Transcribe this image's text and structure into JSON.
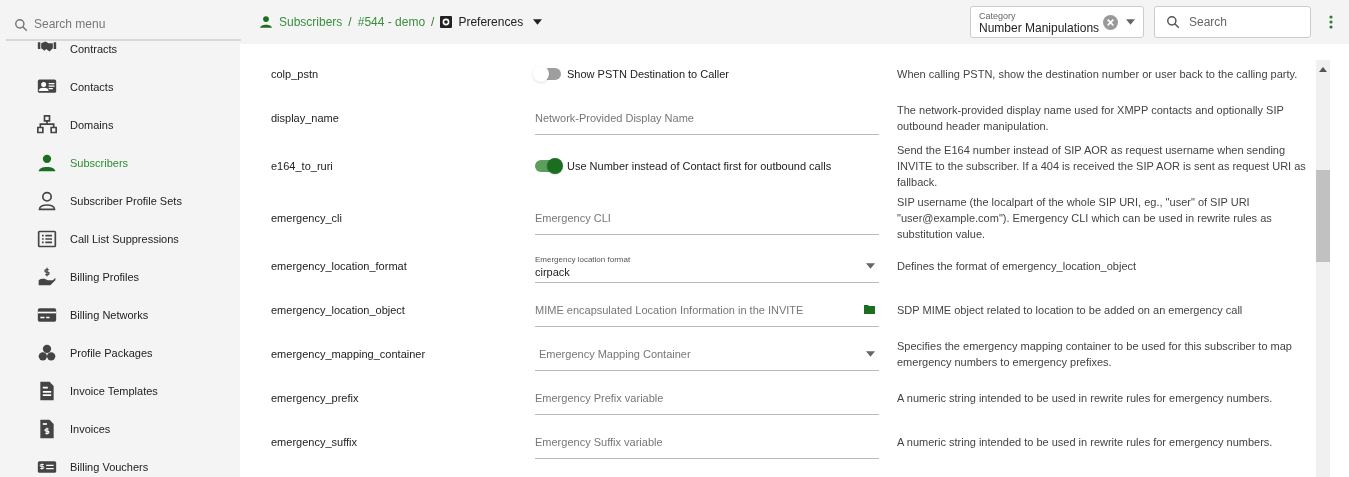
{
  "sidebar": {
    "search": {
      "placeholder": "Search menu"
    },
    "items": [
      {
        "label": "Contracts",
        "selected": false
      },
      {
        "label": "Contacts",
        "selected": false
      },
      {
        "label": "Domains",
        "selected": false
      },
      {
        "label": "Subscribers",
        "selected": true
      },
      {
        "label": "Subscriber Profile Sets",
        "selected": false
      },
      {
        "label": "Call List Suppressions",
        "selected": false
      },
      {
        "label": "Billing Profiles",
        "selected": false
      },
      {
        "label": "Billing Networks",
        "selected": false
      },
      {
        "label": "Profile Packages",
        "selected": false
      },
      {
        "label": "Invoice Templates",
        "selected": false
      },
      {
        "label": "Invoices",
        "selected": false
      },
      {
        "label": "Billing Vouchers",
        "selected": false
      }
    ]
  },
  "breadcrumb": [
    {
      "kind": "link",
      "text": "Subscribers"
    },
    {
      "kind": "separator",
      "text": "/"
    },
    {
      "kind": "link",
      "text": "#544 - demo"
    },
    {
      "kind": "separator",
      "text": "/"
    },
    {
      "kind": "current",
      "text": "Preferences"
    }
  ],
  "category": {
    "label": "Category",
    "value": "Number Manipulations"
  },
  "search": {
    "placeholder": "Search"
  },
  "preferences": [
    {
      "name": "colp_pstn",
      "kind": "toggle",
      "label": "Show PSTN Destination to Caller",
      "on": false,
      "description": "When calling PSTN, show the destination number or user back to the calling party."
    },
    {
      "name": "display_name",
      "kind": "text",
      "placeholder": "Network-Provided Display Name",
      "description": "The network-provided display name used for XMPP contacts and optionally SIP outbound header manipulation."
    },
    {
      "name": "e164_to_ruri",
      "kind": "toggle",
      "label": "Use Number instead of Contact first for outbound calls",
      "on": true,
      "description": "Send the E164 number instead of SIP AOR as request username when sending INVITE to the subscriber. If a 404 is received the SIP AOR is sent as request URI as fallback."
    },
    {
      "name": "emergency_cli",
      "kind": "text",
      "placeholder": "Emergency CLI",
      "description": "SIP username (the localpart of the whole SIP URI, eg., \"user\" of SIP URI \"user@example.com\"). Emergency CLI which can be used in rewrite rules as substitution value."
    },
    {
      "name": "emergency_location_format",
      "kind": "select",
      "label": "Emergency location format",
      "value": "cirpack",
      "description": "Defines the format of emergency_location_object"
    },
    {
      "name": "emergency_location_object",
      "kind": "file",
      "placeholder": "MIME encapsulated Location Information in the INVITE",
      "description": "SDP MIME object related to location to be added on an emergency call"
    },
    {
      "name": "emergency_mapping_container",
      "kind": "select",
      "placeholder": "Emergency Mapping Container",
      "description": "Specifies the emergency mapping container to be used for this subscriber to map emergency numbers to emergency prefixes."
    },
    {
      "name": "emergency_prefix",
      "kind": "text",
      "placeholder": "Emergency Prefix variable",
      "description": "A numeric string intended to be used in rewrite rules for emergency numbers."
    },
    {
      "name": "emergency_suffix",
      "kind": "text",
      "placeholder": "Emergency Suffix variable",
      "description": "A numeric string intended to be used in rewrite rules for emergency numbers."
    }
  ]
}
